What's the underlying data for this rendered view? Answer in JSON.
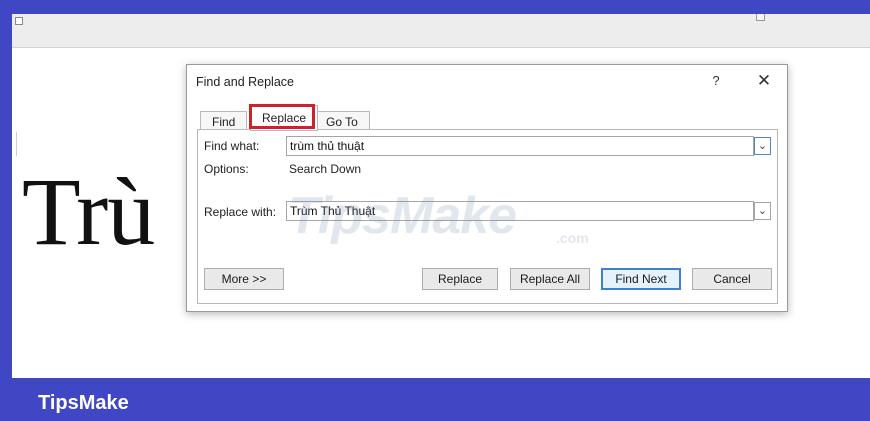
{
  "document": {
    "visible_text": "Trù"
  },
  "watermark": {
    "text": "TipsMake",
    "suffix": ".com"
  },
  "brand_label": "TipsMake",
  "dialog": {
    "title": "Find and Replace",
    "help_label": "?",
    "close_label": "✕",
    "tabs": [
      {
        "label": "Find",
        "active": false
      },
      {
        "label": "Replace",
        "active": true,
        "highlighted": true,
        "highlight_color": "#d0202b"
      },
      {
        "label": "Go To",
        "active": false
      }
    ],
    "find_what": {
      "label": "Find what:",
      "value": "trùm thủ thuật"
    },
    "options": {
      "label": "Options:",
      "value": "Search Down"
    },
    "replace_with": {
      "label": "Replace with:",
      "value": "Trùm Thủ Thuật"
    },
    "buttons": {
      "more": "More >>",
      "replace": "Replace",
      "replace_all": "Replace All",
      "find_next": "Find Next",
      "cancel": "Cancel"
    },
    "dropdown_icon": "chevron-down"
  },
  "colors": {
    "frame": "#3f47c4",
    "primary_button_border": "#3e7fd1"
  }
}
